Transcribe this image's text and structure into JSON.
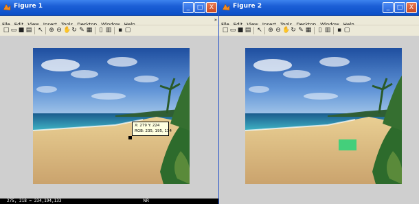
{
  "windows": [
    {
      "title": "Figure 1",
      "menu": [
        "File",
        "Edit",
        "View",
        "Insert",
        "Tools",
        "Desktop",
        "Window",
        "Help"
      ],
      "datatip": {
        "line1": "X: 279 Y: 224",
        "line2": "RGB: 235, 195, 134"
      }
    },
    {
      "title": "Figure 2",
      "menu": [
        "File",
        "Edit",
        "View",
        "Insert",
        "Tools",
        "Desktop",
        "Window",
        "Help"
      ]
    }
  ],
  "statusbar": {
    "text": "275, 218 = 234,194,133",
    "right": "NR"
  },
  "controls": {
    "minimize": "_",
    "maximize": "□",
    "close": "X"
  },
  "menu_overflow": "»",
  "colors": {
    "title_bar": "#0b4fc7",
    "window_bg": "#ece9d8",
    "figure_bg": "#cfcfcf",
    "highlight": "#2fd27a"
  }
}
